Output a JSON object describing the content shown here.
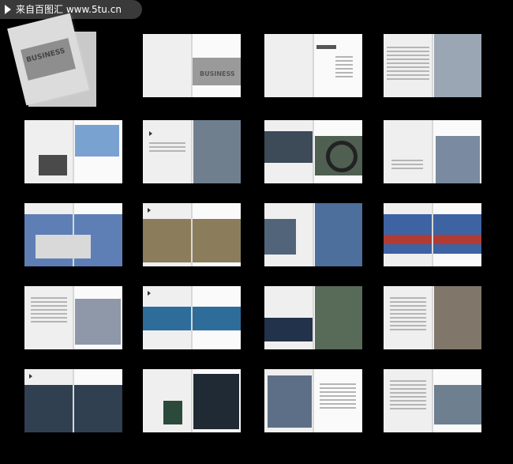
{
  "watermark": {
    "text": "来自百图汇 www.5tu.cn"
  },
  "cover": {
    "text": "BUSINESS"
  },
  "spreads": [
    {
      "label": "BUSINESS"
    },
    {
      "label": ""
    },
    {
      "label": ""
    },
    {
      "label": ""
    },
    {
      "label": ""
    },
    {
      "label": ""
    },
    {
      "label": ""
    },
    {
      "label": ""
    },
    {
      "label": ""
    },
    {
      "label": ""
    },
    {
      "label": ""
    },
    {
      "label": ""
    },
    {
      "label": ""
    },
    {
      "label": ""
    },
    {
      "label": ""
    },
    {
      "label": ""
    },
    {
      "label": ""
    },
    {
      "label": ""
    },
    {
      "label": ""
    }
  ]
}
